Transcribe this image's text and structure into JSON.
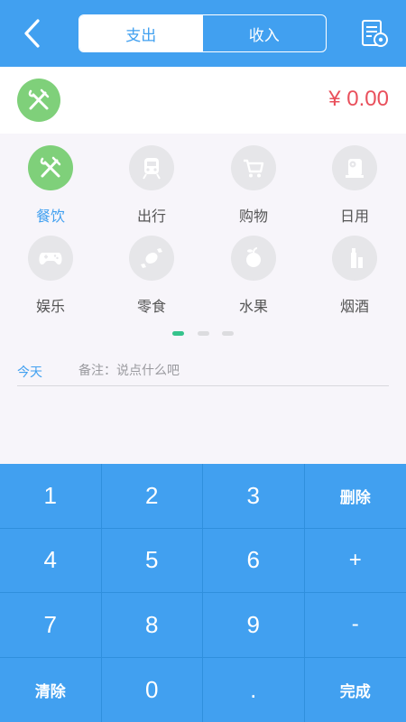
{
  "header": {
    "tabs": [
      {
        "label": "支出",
        "active": true
      },
      {
        "label": "收入",
        "active": false
      }
    ],
    "back_icon": "chevron-left-icon",
    "menu_icon": "list-settings-icon"
  },
  "amount": {
    "value": "¥ 0.00",
    "category_icon": "fork-knife-icon",
    "color": "#e9505c"
  },
  "categories": [
    {
      "label": "餐饮",
      "icon": "fork-knife-icon",
      "active": true
    },
    {
      "label": "出行",
      "icon": "train-icon",
      "active": false
    },
    {
      "label": "购物",
      "icon": "shopping-cart-icon",
      "active": false
    },
    {
      "label": "日用",
      "icon": "tissue-roll-icon",
      "active": false
    },
    {
      "label": "娱乐",
      "icon": "gamepad-icon",
      "active": false
    },
    {
      "label": "零食",
      "icon": "candy-icon",
      "active": false
    },
    {
      "label": "水果",
      "icon": "fruit-icon",
      "active": false
    },
    {
      "label": "烟酒",
      "icon": "bottle-icon",
      "active": false
    }
  ],
  "pager": {
    "page_count": 3,
    "current_page": 1
  },
  "note": {
    "date_label": "今天",
    "placeholder": "备注：说点什么吧",
    "value": ""
  },
  "keypad": {
    "keys": [
      "1",
      "2",
      "3",
      "删除",
      "4",
      "5",
      "6",
      "+",
      "7",
      "8",
      "9",
      "-",
      "清除",
      "0",
      ".",
      "完成"
    ]
  },
  "colors": {
    "primary": "#41a0f0",
    "accent_green": "#7fd07a",
    "pager_active": "#35c38c",
    "amount_red": "#e9505c"
  }
}
